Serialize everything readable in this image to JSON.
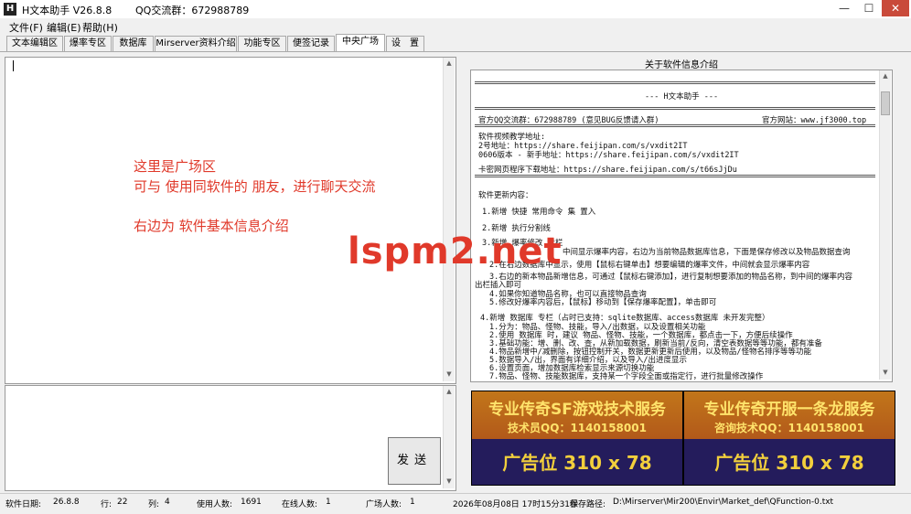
{
  "window": {
    "icon_letter": "H",
    "title": "H文本助手  V26.8.8",
    "qq_group": "QQ交流群：672988789",
    "min_symbol": "—",
    "max_symbol": "☐",
    "close_symbol": "✕"
  },
  "menu": [
    "文件(F)",
    "编辑(E)",
    "帮助(H)"
  ],
  "tabs": [
    "文本编辑区",
    "爆率专区",
    "数据库",
    "Mirserver资料介绍",
    "功能专区",
    "便签记录",
    "中央广场",
    "设　置"
  ],
  "active_tab": "中央广场",
  "plaza": {
    "line1": "这里是广场区",
    "line2": "可与  使用同软件的 朋友，进行聊天交流",
    "line3": "右边为 软件基本信息介绍",
    "send_label": "发送"
  },
  "info": {
    "title": "关于软件信息介绍",
    "lines": [
      "---  H文本助手  ---",
      "官方QQ交流群：672988789 (意见BUG反馈请入群)",
      "官方网站：www.jf3000.top",
      "软件视频教学地址:",
      "2号地址：https://share.feijipan.com/s/vxdit2IT",
      "0606版本 - 新手地址：https://share.feijipan.com/s/vxdit2IT",
      "卡密网页程序下载地址：https://share.feijipan.com/s/t66sJjDu",
      "软件更新内容：",
      "1.新增 快捷 常用命令 集 置入",
      "2.新增 执行分割线",
      "3.新增 爆率修改 专栏",
      "中间显示爆率内容，右边为当前物品数据库信息，下面是保存修改以及物品数据查询",
      "2.在右边数据库中显示，使用【鼠标右键单击】想要编辑的爆率文件，中间就会显示爆率内容",
      "3.右边的新本物品新增信息，可通过【鼠标右键添加】，进行复制想要添加的物品名称，到中间的爆率内容",
      "出栏插入即可",
      "4.如果你知道物品名称，也可以直接物品查询",
      "5.修改好爆率内容后，【鼠标】移动到【保存爆率配置】，单击即可",
      "4.新增 数据库 专栏（占时已支持：sqlite数据库、access数据库 未开发完整）",
      "1.分为：物品、怪物、技能，导入/出数据，以及设置相关功能",
      "2.使用 数据库 时，建议 物品、怪物、技能，一个数据库，都点击一下，方便后续操作",
      "3.基础功能：增、删、改、查，从新加载数据，刷新当前/反向，清空表数据等等功能，都有准备",
      "4.物品新增中/减删除，按钮控制开关，数据更新更新后使用，以及物品/怪物名排序等等功能",
      "5.数据导入/出，界面有详细介绍，以及导入/出进度显示",
      "6.设置页面，增加数据库检索显示来源切换功能",
      "7.物品、怪物、技能数据库，支持某一个字段全面或指定行，进行批量修改操作"
    ]
  },
  "ads": [
    {
      "headline": "专业传奇SF游戏技术服务",
      "contact": "技术员QQ：1140158001",
      "slot": "广告位   310 x 78"
    },
    {
      "headline": "专业传奇开服一条龙服务",
      "contact": "咨询技术QQ：1140158001",
      "slot": "广告位   310 x 78"
    }
  ],
  "status": {
    "version_label": "软件日期:",
    "version": "26.8.8",
    "row_label": "行:",
    "row": "22",
    "col_label": "列:",
    "col": "4",
    "users_label": "使用人数:",
    "users": "1691",
    "online_label": "在线人数:",
    "online": "1",
    "plaza_label": "广场人数:",
    "plaza": "1",
    "datetime": "2026年08月08日 17时15分31秒",
    "path_label": "保存路径:",
    "path": "D:\\Mirserver\\Mir200\\Envir\\Market_def\\QFunction-0.txt"
  },
  "watermark": "lspm2.net",
  "colors": {
    "accent_red": "#e0392a",
    "ad_orange": "#c2761a",
    "ad_navy": "#241c5c",
    "ad_text": "#ffe36b"
  }
}
